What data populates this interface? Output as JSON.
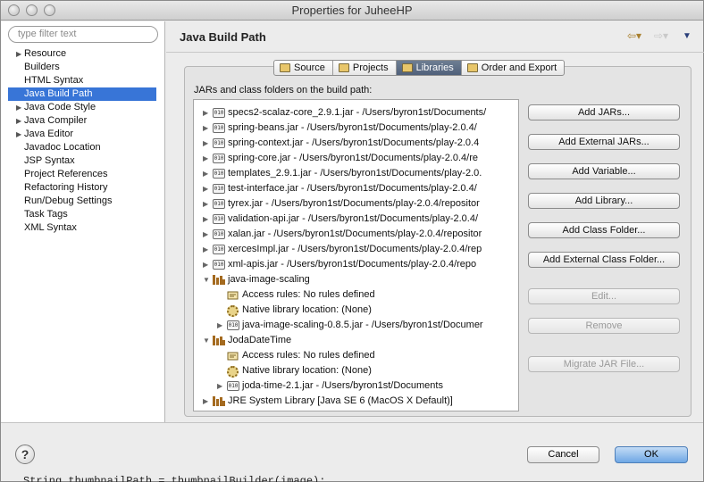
{
  "window": {
    "title": "Properties for JuheeHP"
  },
  "filter": {
    "placeholder": "type filter text"
  },
  "nav": {
    "items": [
      {
        "label": "Resource",
        "expandable": true
      },
      {
        "label": "Builders",
        "expandable": false
      },
      {
        "label": "HTML Syntax",
        "expandable": false
      },
      {
        "label": "Java Build Path",
        "expandable": false,
        "selected": true
      },
      {
        "label": "Java Code Style",
        "expandable": true
      },
      {
        "label": "Java Compiler",
        "expandable": true
      },
      {
        "label": "Java Editor",
        "expandable": true
      },
      {
        "label": "Javadoc Location",
        "expandable": false
      },
      {
        "label": "JSP Syntax",
        "expandable": false
      },
      {
        "label": "Project References",
        "expandable": false
      },
      {
        "label": "Refactoring History",
        "expandable": false
      },
      {
        "label": "Run/Debug Settings",
        "expandable": false
      },
      {
        "label": "Task Tags",
        "expandable": false
      },
      {
        "label": "XML Syntax",
        "expandable": false
      }
    ]
  },
  "header": {
    "title": "Java Build Path"
  },
  "tabs": [
    {
      "label": "Source",
      "active": false
    },
    {
      "label": "Projects",
      "active": false
    },
    {
      "label": "Libraries",
      "active": true
    },
    {
      "label": "Order and Export",
      "active": false
    }
  ],
  "libraries": {
    "heading": "JARs and class folders on the build path:",
    "rows": [
      {
        "text": "specs2-scalaz-core_2.9.1.jar - /Users/byron1st/Documents/",
        "icon": "jar"
      },
      {
        "text": "spring-beans.jar - /Users/byron1st/Documents/play-2.0.4/",
        "icon": "jar"
      },
      {
        "text": "spring-context.jar - /Users/byron1st/Documents/play-2.0.4",
        "icon": "jar"
      },
      {
        "text": "spring-core.jar - /Users/byron1st/Documents/play-2.0.4/re",
        "icon": "jar"
      },
      {
        "text": "templates_2.9.1.jar - /Users/byron1st/Documents/play-2.0.",
        "icon": "jar"
      },
      {
        "text": "test-interface.jar - /Users/byron1st/Documents/play-2.0.4/",
        "icon": "jar"
      },
      {
        "text": "tyrex.jar - /Users/byron1st/Documents/play-2.0.4/repositor",
        "icon": "jar"
      },
      {
        "text": "validation-api.jar - /Users/byron1st/Documents/play-2.0.4/",
        "icon": "jar"
      },
      {
        "text": "xalan.jar - /Users/byron1st/Documents/play-2.0.4/repositor",
        "icon": "jar"
      },
      {
        "text": "xercesImpl.jar - /Users/byron1st/Documents/play-2.0.4/rep",
        "icon": "jar"
      },
      {
        "text": "xml-apis.jar - /Users/byron1st/Documents/play-2.0.4/repo",
        "icon": "jar"
      },
      {
        "text": "java-image-scaling",
        "icon": "lib",
        "expanded": true
      },
      {
        "text": "Access rules: No rules defined",
        "icon": "rule",
        "child": true
      },
      {
        "text": "Native library location: (None)",
        "icon": "native",
        "child": true
      },
      {
        "text": "java-image-scaling-0.8.5.jar - /Users/byron1st/Documer",
        "icon": "jar",
        "child": true,
        "expandable": true
      },
      {
        "text": "JodaDateTime",
        "icon": "lib",
        "expanded": true
      },
      {
        "text": "Access rules: No rules defined",
        "icon": "rule",
        "child": true
      },
      {
        "text": "Native library location: (None)",
        "icon": "native",
        "child": true
      },
      {
        "text": "joda-time-2.1.jar - /Users/byron1st/Documents",
        "icon": "jar",
        "child": true,
        "expandable": true
      },
      {
        "text": "JRE System Library [Java SE 6 (MacOS X Default)]",
        "icon": "lib",
        "expanded": false
      }
    ]
  },
  "buttons": {
    "add_jars": "Add JARs...",
    "add_external_jars": "Add External JARs...",
    "add_variable": "Add Variable...",
    "add_library": "Add Library...",
    "add_class_folder": "Add Class Folder...",
    "add_external_class_folder": "Add External Class Folder...",
    "edit": "Edit...",
    "remove": "Remove",
    "migrate_jar": "Migrate JAR File..."
  },
  "footer": {
    "help": "?",
    "cancel": "Cancel",
    "ok": "OK"
  },
  "background_code": "String thumbnailPath = thumbnailBuilder(image);",
  "colors": {
    "selection": "#3875d7",
    "ok_button": "#6fa7e5"
  }
}
